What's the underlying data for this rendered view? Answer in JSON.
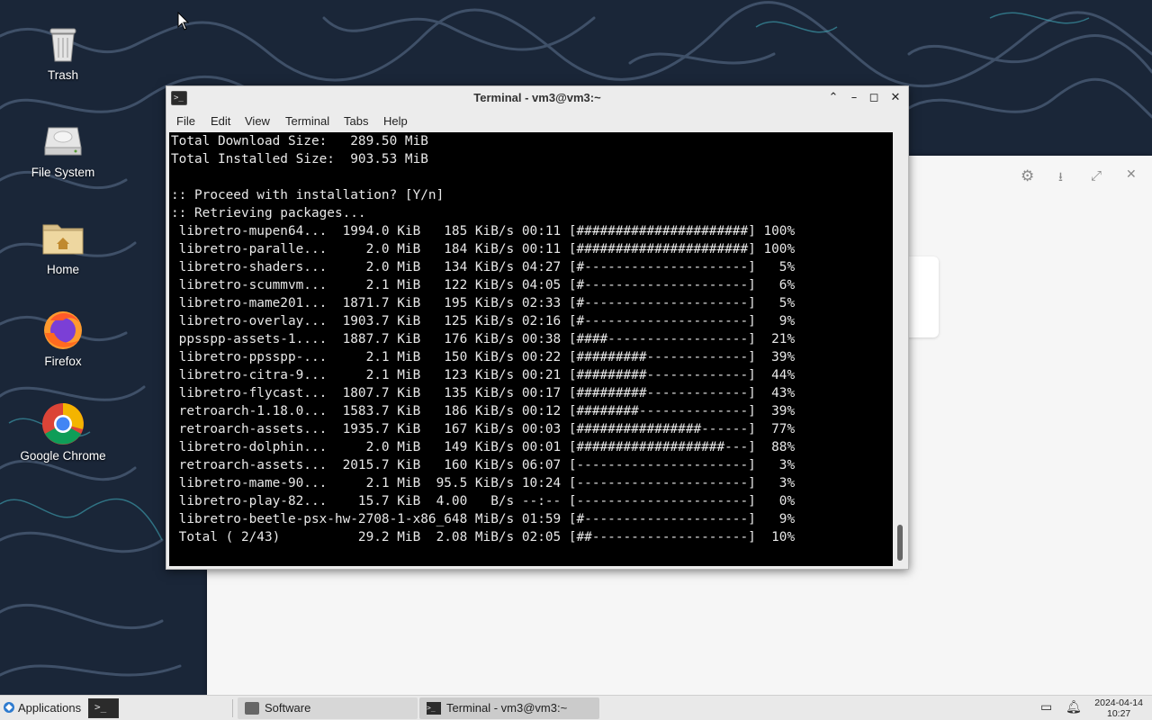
{
  "desktop": {
    "icons": [
      {
        "label": "Trash",
        "icon": "trash-icon"
      },
      {
        "label": "File System",
        "icon": "drive-icon"
      },
      {
        "label": "Home",
        "icon": "home-folder-icon"
      },
      {
        "label": "Firefox",
        "icon": "firefox-icon"
      },
      {
        "label": "Google Chrome",
        "icon": "chrome-icon"
      }
    ]
  },
  "terminal": {
    "title": "Terminal - vm3@vm3:~",
    "menu": [
      "File",
      "Edit",
      "View",
      "Terminal",
      "Tabs",
      "Help"
    ],
    "lines": [
      "Total Download Size:   289.50 MiB",
      "Total Installed Size:  903.53 MiB",
      "",
      ":: Proceed with installation? [Y/n]",
      ":: Retrieving packages...",
      " libretro-mupen64...  1994.0 KiB   185 KiB/s 00:11 [######################] 100%",
      " libretro-paralle...     2.0 MiB   184 KiB/s 00:11 [######################] 100%",
      " libretro-shaders...     2.0 MiB   134 KiB/s 04:27 [#---------------------]   5%",
      " libretro-scummvm...     2.1 MiB   122 KiB/s 04:05 [#---------------------]   6%",
      " libretro-mame201...  1871.7 KiB   195 KiB/s 02:33 [#---------------------]   5%",
      " libretro-overlay...  1903.7 KiB   125 KiB/s 02:16 [#---------------------]   9%",
      " ppsspp-assets-1....  1887.7 KiB   176 KiB/s 00:38 [####------------------]  21%",
      " libretro-ppsspp-...     2.1 MiB   150 KiB/s 00:22 [#########-------------]  39%",
      " libretro-citra-9...     2.1 MiB   123 KiB/s 00:21 [#########-------------]  44%",
      " libretro-flycast...  1807.7 KiB   135 KiB/s 00:17 [#########-------------]  43%",
      " retroarch-1.18.0...  1583.7 KiB   186 KiB/s 00:12 [########--------------]  39%",
      " retroarch-assets...  1935.7 KiB   167 KiB/s 00:03 [################------]  77%",
      " libretro-dolphin...     2.0 MiB   149 KiB/s 00:01 [###################---]  88%",
      " retroarch-assets...  2015.7 KiB   160 KiB/s 06:07 [----------------------]   3%",
      " libretro-mame-90...     2.1 MiB  95.5 KiB/s 10:24 [----------------------]   3%",
      " libretro-play-82...    15.7 KiB  4.00   B/s --:-- [----------------------]   0%",
      " libretro-beetle-psx-hw-2708-1-x86_648 MiB/s 01:59 [#---------------------]   9%",
      " Total ( 2/43)          29.2 MiB  2.08 MiB/s 02:05 [##--------------------]  10%"
    ]
  },
  "taskbar": {
    "applications_label": "Applications",
    "tasks": [
      {
        "label": "Software",
        "icon": "software-icon"
      },
      {
        "label": "Terminal - vm3@vm3:~",
        "icon": "terminal-icon"
      }
    ],
    "clock_date": "2024-04-14",
    "clock_time": "10:27"
  },
  "colors": {
    "wallpaper": "#1a2638",
    "terminal_bg": "#000000",
    "terminal_fg": "#e8e8e8",
    "chrome": "#ececec"
  }
}
